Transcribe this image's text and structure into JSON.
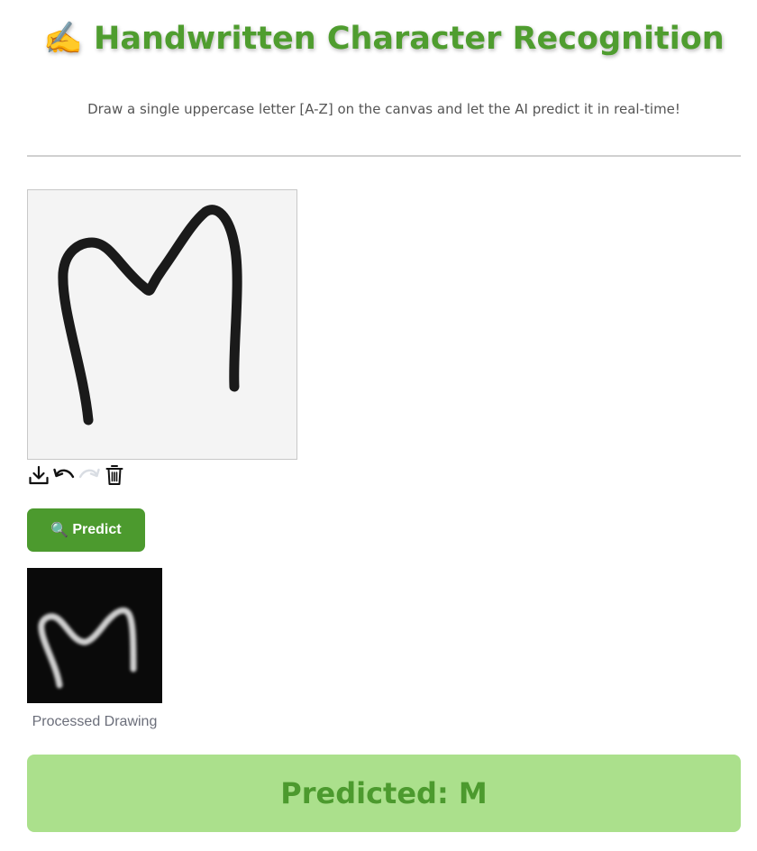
{
  "header": {
    "icon": "writing-hand-emoji",
    "icon_glyph": "✍️",
    "title": "Handwritten Character Recognition",
    "subtitle": "Draw a single uppercase letter [A-Z] on the canvas and let the AI predict it in real-time!"
  },
  "canvas": {
    "background": "#f4f4f4",
    "stroke_color": "#1a1a1a",
    "drawn_letter": "M"
  },
  "toolbar": {
    "tools": [
      "download-icon",
      "undo-icon",
      "redo-icon",
      "trash-icon"
    ],
    "redo_enabled": false
  },
  "predict_button": {
    "icon": "magnifier-emoji",
    "icon_glyph": "🔍",
    "label": "Predict"
  },
  "processed": {
    "caption": "Processed Drawing"
  },
  "result": {
    "label": "Predicted: M",
    "background": "#abe08c",
    "text_color": "#4c9a2e"
  },
  "colors": {
    "accent": "#4c9a2e",
    "title": "#4f9d2f"
  }
}
